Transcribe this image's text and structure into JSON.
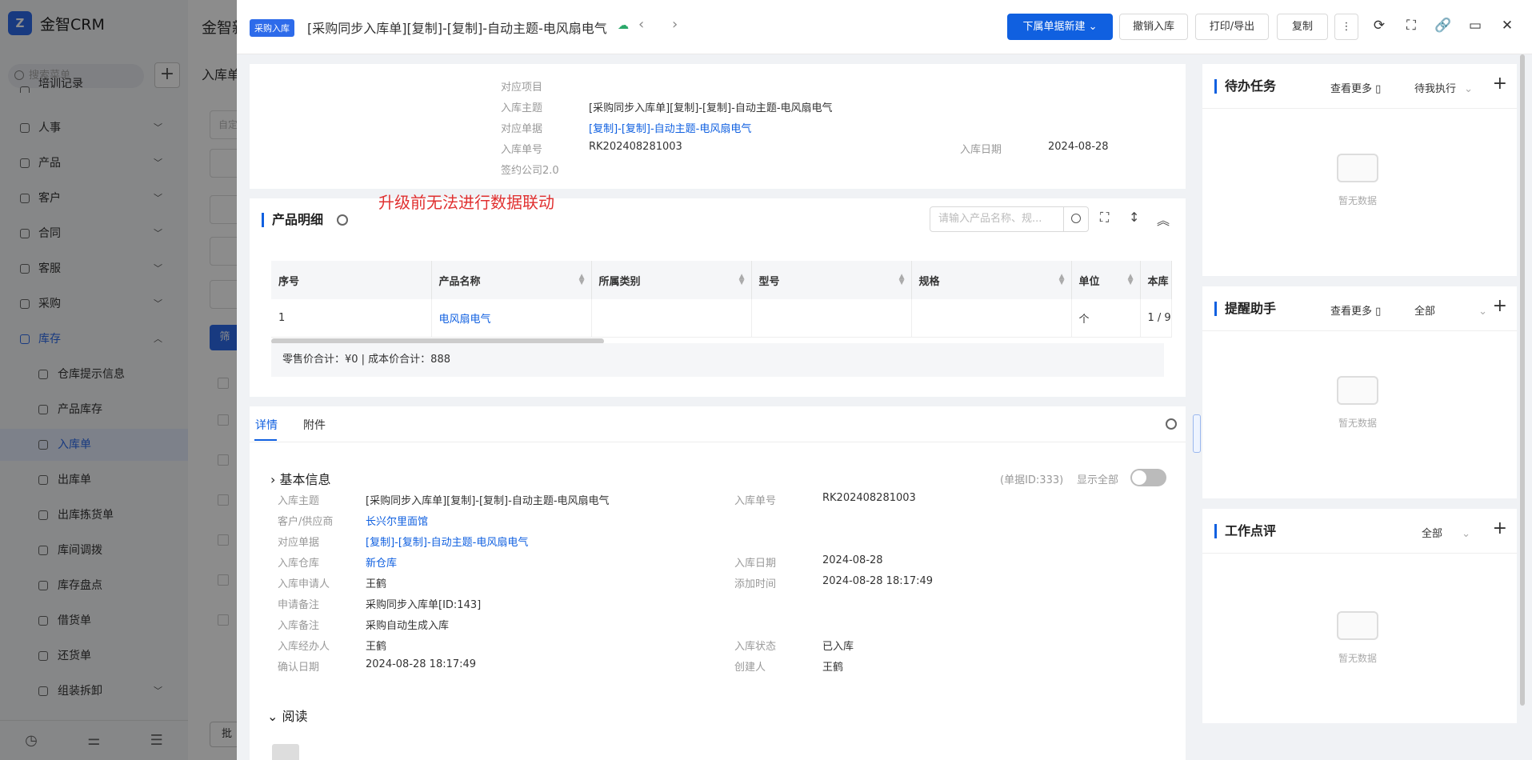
{
  "sidebar": {
    "app_name": "金智CRM",
    "logo_letter": "Z",
    "search_placeholder": "搜索菜单",
    "partial_item": "培训记录",
    "items": [
      {
        "label": "人事",
        "icon": "user-icon"
      },
      {
        "label": "产品",
        "icon": "cube-icon"
      },
      {
        "label": "客户",
        "icon": "chart-icon"
      },
      {
        "label": "合同",
        "icon": "contract-icon"
      },
      {
        "label": "客服",
        "icon": "headset-icon"
      },
      {
        "label": "采购",
        "icon": "cart-icon"
      },
      {
        "label": "库存",
        "icon": "warehouse-icon"
      }
    ],
    "sub_items": [
      "仓库提示信息",
      "产品库存",
      "入库单",
      "出库单",
      "出库拣货单",
      "库间调拨",
      "库存盘点",
      "借货单",
      "还货单",
      "组装拆卸"
    ],
    "active_sub": "入库单"
  },
  "background_page": {
    "tab_label": "金智新",
    "title": "入库单",
    "filter_placeholder": "自定",
    "button_label": "筛",
    "bottom_label": "批量"
  },
  "drawer": {
    "badge": "采购入库",
    "title": "[采购同步入库单][复制]-[复制]-自动主题-电风扇电气",
    "buttons": {
      "new_sub": "下属单据新建",
      "revoke": "撤销入库",
      "print": "打印/导出",
      "copy": "复制"
    },
    "top_info": {
      "project_label": "对应项目",
      "subject_label": "入库主题",
      "subject_value": "[采购同步入库单][复制]-[复制]-自动主题-电风扇电气",
      "ref_label": "对应单据",
      "ref_value": "[复制]-[复制]-自动主题-电风扇电气",
      "number_label": "入库单号",
      "number_value": "RK202408281003",
      "date_label": "入库日期",
      "date_value": "2024-08-28",
      "company_label": "签约公司2.0"
    },
    "annotation": "升级前无法进行数据联动",
    "products": {
      "title": "产品明细",
      "search_placeholder": "请输入产品名称、规...",
      "columns": [
        "序号",
        "产品名称",
        "所属类别",
        "型号",
        "规格",
        "单位",
        "本库"
      ],
      "rows": [
        {
          "no": "1",
          "name": "电风扇电气",
          "category": "",
          "model": "",
          "spec": "",
          "unit": "个",
          "stock": "1 / 9"
        }
      ],
      "summary": "零售价合计：¥0 |   成本价合计：888"
    },
    "tabs": [
      "详情",
      "附件"
    ],
    "basic": {
      "title": "基本信息",
      "doc_id": "(单据ID:333)",
      "show_all": "显示全部",
      "left": [
        {
          "k": "入库主题",
          "v": "[采购同步入库单][复制]-[复制]-自动主题-电风扇电气",
          "link": false
        },
        {
          "k": "客户/供应商",
          "v": "长兴尔里面馆",
          "link": true
        },
        {
          "k": "对应单据",
          "v": "[复制]-[复制]-自动主题-电风扇电气",
          "link": true
        },
        {
          "k": "入库仓库",
          "v": "新仓库",
          "link": true
        },
        {
          "k": "入库申请人",
          "v": "王鹤",
          "link": false
        },
        {
          "k": "申请备注",
          "v": "采购同步入库单[ID:143]",
          "link": false
        },
        {
          "k": "入库备注",
          "v": "采购自动生成入库",
          "link": false
        },
        {
          "k": "入库经办人",
          "v": "王鹤",
          "link": false
        },
        {
          "k": "确认日期",
          "v": "2024-08-28 18:17:49",
          "link": false
        }
      ],
      "right": [
        {
          "k": "入库单号",
          "v": "RK202408281003"
        },
        {
          "k": "入库日期",
          "v": "2024-08-28"
        },
        {
          "k": "添加时间",
          "v": "2024-08-28 18:17:49"
        },
        {
          "k": "入库状态",
          "v": "已入库"
        },
        {
          "k": "创建人",
          "v": "王鹤"
        }
      ]
    },
    "read_title": "阅读"
  },
  "right_panel": {
    "todo": {
      "title": "待办任务",
      "more": "查看更多",
      "filter": "待我执行",
      "empty": "暂无数据"
    },
    "reminder": {
      "title": "提醒助手",
      "more": "查看更多",
      "filter": "全部",
      "empty": "暂无数据"
    },
    "review": {
      "title": "工作点评",
      "filter": "全部",
      "empty": "暂无数据"
    }
  }
}
